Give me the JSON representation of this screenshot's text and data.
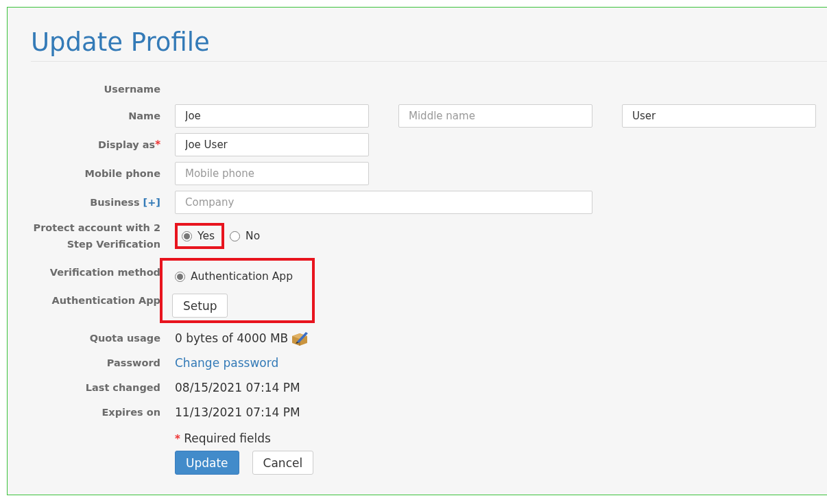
{
  "title": "Update Profile",
  "rows": [
    {
      "kind": "empty",
      "label": "Username"
    },
    {
      "kind": "inputs",
      "label": "Name",
      "fields": [
        {
          "kind": "normal",
          "value": "Joe"
        },
        {
          "kind": "normal",
          "placeholder": "Middle name"
        },
        {
          "kind": "normal",
          "value": "User"
        }
      ]
    },
    {
      "kind": "inputs",
      "label": "Display as",
      "required_mark": "*",
      "fields": [
        {
          "kind": "normal",
          "value": "Joe User"
        }
      ]
    },
    {
      "kind": "inputs",
      "label": "Mobile phone",
      "fields": [
        {
          "kind": "normal",
          "placeholder": "Mobile phone"
        }
      ]
    },
    {
      "kind": "inputs",
      "label": "Business",
      "label_link": "[+]",
      "fields": [
        {
          "kind": "wide",
          "placeholder": "Company"
        }
      ]
    },
    {
      "kind": "radios",
      "label": "Protect account with 2 Step Verification",
      "options": [
        {
          "label": "Yes",
          "selected": true,
          "highlighted": true
        },
        {
          "label": "No",
          "selected": false,
          "highlighted": false
        }
      ]
    },
    {
      "kind": "group",
      "highlighted": true,
      "rows": [
        {
          "kind": "radios",
          "label": "Verification method",
          "options": [
            {
              "label": "Authentication App",
              "selected": true,
              "highlighted": false
            }
          ]
        },
        {
          "kind": "button",
          "label": "Authentication App",
          "button": "Setup"
        }
      ]
    },
    {
      "kind": "quota",
      "label": "Quota usage",
      "value": "0 bytes of 4000 MB"
    },
    {
      "kind": "link",
      "label": "Password",
      "value": "Change password"
    },
    {
      "kind": "text",
      "label": "Last changed",
      "value": "08/15/2021 07:14 PM"
    },
    {
      "kind": "text",
      "label": "Expires on",
      "value": "11/13/2021 07:14 PM"
    }
  ],
  "required_note": {
    "mark": "*",
    "text": "Required fields"
  },
  "actions": [
    {
      "kind": "primary",
      "label": "Update"
    },
    {
      "kind": "default",
      "label": "Cancel"
    }
  ]
}
